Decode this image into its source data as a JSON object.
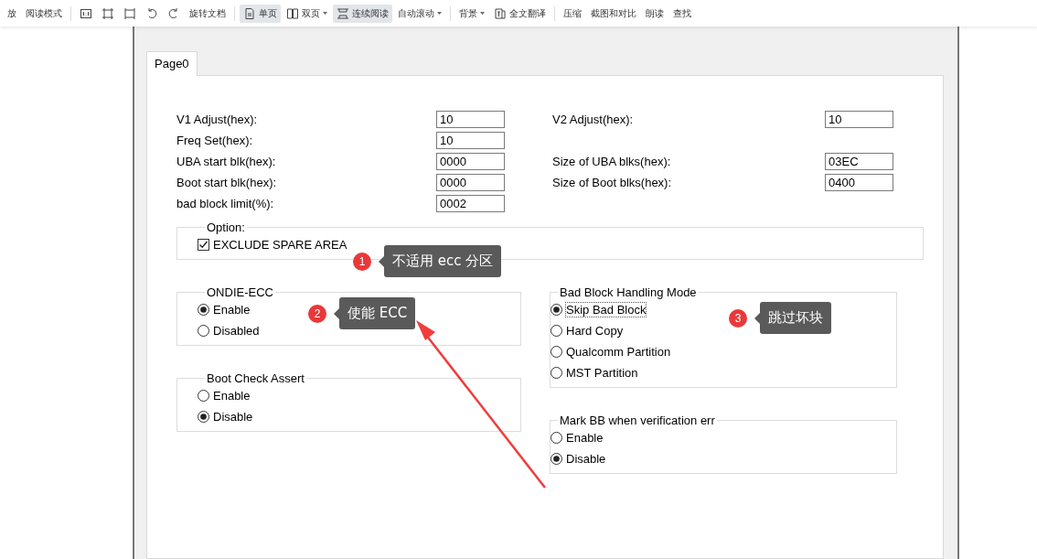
{
  "toolbar": {
    "items": [
      {
        "kind": "text",
        "label": "放",
        "selected": false,
        "dropdown": false
      },
      {
        "kind": "text",
        "label": "阅读模式",
        "selected": false,
        "dropdown": false
      },
      {
        "kind": "separator"
      },
      {
        "kind": "icon"
      },
      {
        "kind": "icon"
      },
      {
        "kind": "icon"
      },
      {
        "kind": "icon"
      },
      {
        "kind": "icon"
      },
      {
        "kind": "text",
        "label": "旋转文档",
        "selected": false,
        "dropdown": false
      },
      {
        "kind": "separator"
      },
      {
        "kind": "icon_text",
        "label": "单页",
        "selected": true,
        "dropdown": false
      },
      {
        "kind": "icon_text",
        "label": "双页",
        "selected": false,
        "dropdown": true
      },
      {
        "kind": "icon_text",
        "label": "连续阅读",
        "selected": true,
        "dropdown": false
      },
      {
        "kind": "text",
        "label": "自动滚动",
        "selected": false,
        "dropdown": true
      },
      {
        "kind": "separator"
      },
      {
        "kind": "text",
        "label": "背景",
        "selected": false,
        "dropdown": true
      },
      {
        "kind": "icon_text",
        "label": "全文翻译",
        "selected": false,
        "dropdown": false
      },
      {
        "kind": "separator"
      },
      {
        "kind": "text",
        "label": "压缩",
        "selected": false,
        "dropdown": false
      },
      {
        "kind": "text",
        "label": "截图和对比",
        "selected": false,
        "dropdown": false
      },
      {
        "kind": "text",
        "label": "朗读",
        "selected": false,
        "dropdown": false
      },
      {
        "kind": "text",
        "label": "查找",
        "selected": false,
        "dropdown": false
      }
    ]
  },
  "tabs": [
    {
      "label": "Page0",
      "selected": true
    }
  ],
  "fields": [
    {
      "left": {
        "label": "V1 Adjust(hex):",
        "value": "10"
      },
      "right": {
        "label": "V2 Adjust(hex):",
        "value": "10"
      }
    },
    {
      "left": {
        "label": "Freq Set(hex):",
        "value": "10"
      }
    },
    {
      "left": {
        "label": "UBA start blk(hex):",
        "value": "0000"
      },
      "right": {
        "label": "Size of UBA blks(hex):",
        "value": "03EC"
      }
    },
    {
      "left": {
        "label": "Boot start blk(hex):",
        "value": "0000"
      },
      "right": {
        "label": "Size of Boot blks(hex):",
        "value": "0400"
      }
    },
    {
      "left": {
        "label": "bad block limit(%):",
        "value": "0002"
      }
    }
  ],
  "option": {
    "title": "Option:",
    "checkbox": {
      "label": "EXCLUDE SPARE AREA",
      "checked": true
    }
  },
  "left_groups": [
    {
      "title": "ONDIE-ECC",
      "options": [
        {
          "label": "Enable",
          "selected": true,
          "focused": false
        },
        {
          "label": "Disabled",
          "selected": false,
          "focused": false
        }
      ]
    },
    {
      "title": "Boot Check Assert",
      "options": [
        {
          "label": "Enable",
          "selected": false,
          "focused": false
        },
        {
          "label": "Disable",
          "selected": true,
          "focused": false
        }
      ]
    }
  ],
  "right_groups": [
    {
      "title": "Bad Block Handling Mode",
      "options": [
        {
          "label": "Skip Bad Block",
          "selected": true,
          "focused": true
        },
        {
          "label": "Hard Copy",
          "selected": false,
          "focused": false
        },
        {
          "label": "Qualcomm Partition",
          "selected": false,
          "focused": false
        },
        {
          "label": "MST Partition",
          "selected": false,
          "focused": false
        }
      ]
    },
    {
      "title": "Mark BB when verification err",
      "options": [
        {
          "label": "Enable",
          "selected": false,
          "focused": false
        },
        {
          "label": "Disable",
          "selected": true,
          "focused": false
        }
      ]
    }
  ],
  "annotations": [
    {
      "number": "1",
      "text": "不适用 ecc 分区"
    },
    {
      "number": "2",
      "text": "使能 ECC"
    },
    {
      "number": "3",
      "text": "跳过坏块"
    }
  ]
}
